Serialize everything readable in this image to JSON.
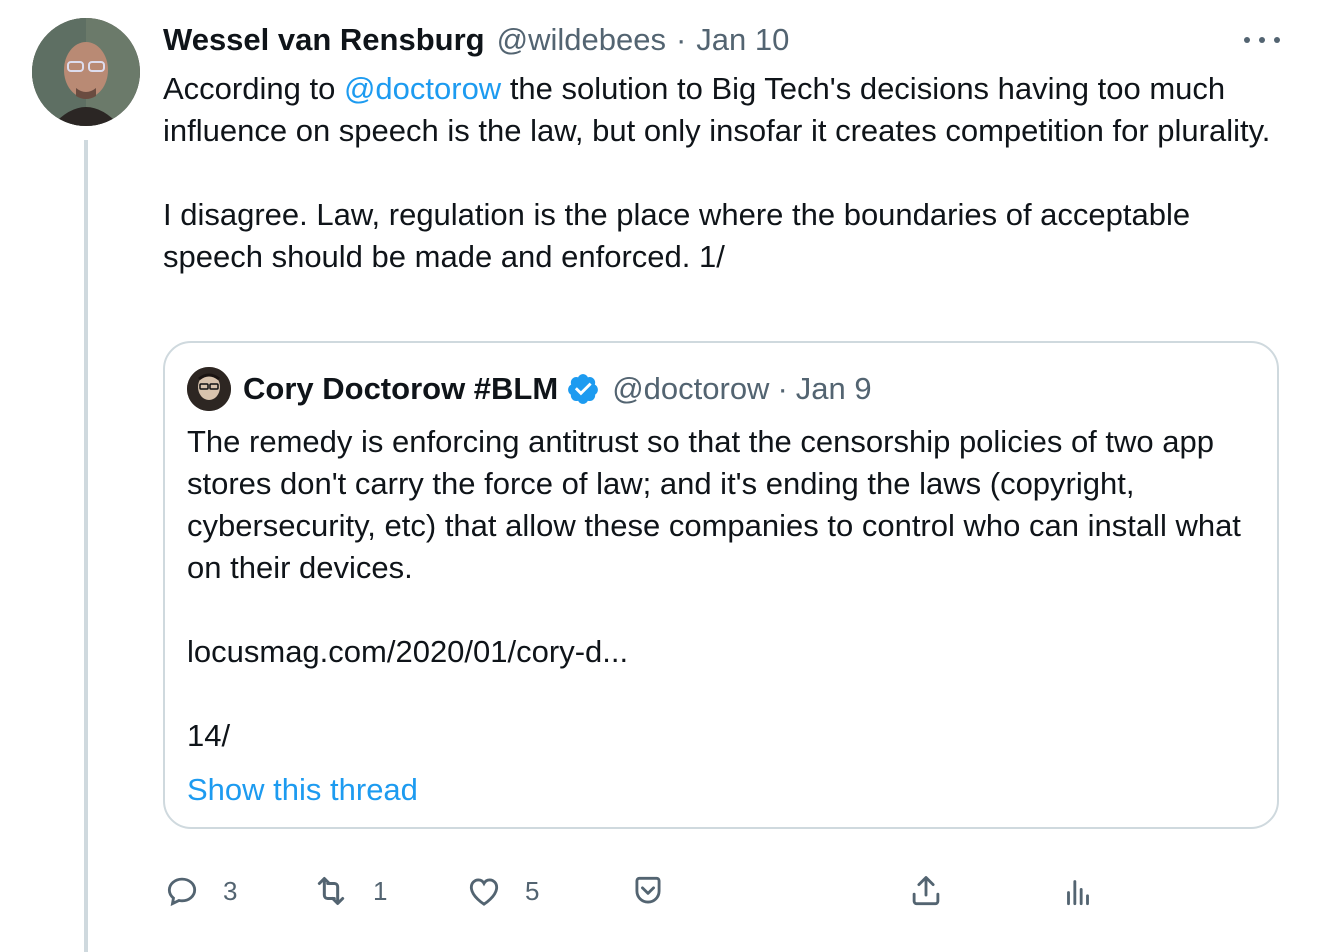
{
  "tweet": {
    "author_name": "Wessel van Rensburg",
    "author_handle": "@wildebees",
    "separator": "·",
    "date": "Jan 10",
    "text_before_mention": "According to ",
    "mention": "@doctorow",
    "text_after_mention": " the solution to Big Tech's decisions having too much influence on speech is the law, but only insofar it creates competition for plurality.",
    "paragraph2": "I disagree. Law, regulation is the place where the boundaries of acceptable speech should be made and enforced. 1/"
  },
  "quote": {
    "author_name": "Cory Doctorow #BLM",
    "author_handle": "@doctorow",
    "separator": "·",
    "date": "Jan 9",
    "paragraph1": "The remedy is enforcing antitrust so that the censorship policies of two app stores don't carry the force of law; and it's ending the laws (copyright, cybersecurity, etc) that allow these companies to control who can install what on their devices.",
    "link": "locusmag.com/2020/01/cory-d...",
    "paragraph3": "14/",
    "show_thread": "Show this thread"
  },
  "actions": {
    "reply_count": "3",
    "retweet_count": "1",
    "like_count": "5"
  },
  "colors": {
    "accent": "#1d9bf0",
    "text": "#0f1419",
    "secondary": "#536471",
    "border": "#cfd9de"
  },
  "icons": [
    "more-icon",
    "verified-badge-icon",
    "reply-icon",
    "retweet-icon",
    "like-icon",
    "bookmark-icon",
    "share-icon",
    "analytics-icon"
  ]
}
